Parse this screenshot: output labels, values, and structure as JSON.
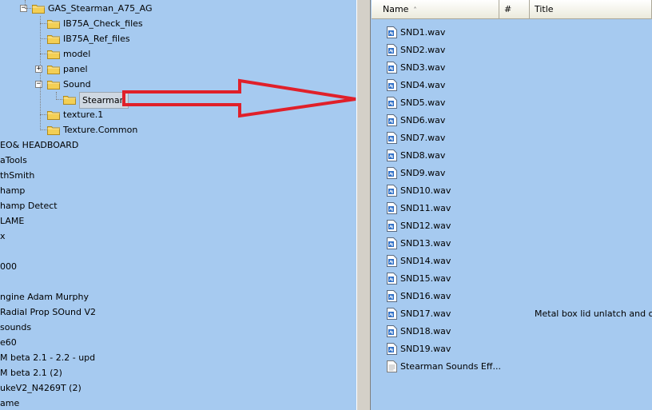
{
  "tree": {
    "items": [
      {
        "label": "GAS_Stearman_A75_AG",
        "type": "folder",
        "expander": "−"
      },
      {
        "label": "IB75A_Check_files",
        "type": "folder"
      },
      {
        "label": "IB75A_Ref_files",
        "type": "folder"
      },
      {
        "label": "model",
        "type": "folder"
      },
      {
        "label": "panel",
        "type": "folder",
        "expander": "+"
      },
      {
        "label": "Sound",
        "type": "folder",
        "expander": "−"
      },
      {
        "label": "Stearman",
        "type": "folder",
        "selected": true
      },
      {
        "label": "texture.1",
        "type": "folder"
      },
      {
        "label": "Texture.Common",
        "type": "folder"
      },
      {
        "label": "EO& HEADBOARD",
        "type": "text"
      },
      {
        "label": "aTools",
        "type": "text"
      },
      {
        "label": "thSmith",
        "type": "text"
      },
      {
        "label": "hamp",
        "type": "text"
      },
      {
        "label": "hamp Detect",
        "type": "text"
      },
      {
        "label": "LAME",
        "type": "text"
      },
      {
        "label": "x",
        "type": "text"
      },
      {
        "label": "",
        "type": "text"
      },
      {
        "label": "000",
        "type": "text"
      },
      {
        "label": "",
        "type": "text"
      },
      {
        "label": "ngine Adam Murphy",
        "type": "text"
      },
      {
        "label": "Radial Prop SOund V2",
        "type": "text"
      },
      {
        "label": "sounds",
        "type": "text"
      },
      {
        "label": "e60",
        "type": "text"
      },
      {
        "label": "M beta 2.1 - 2.2 - upd",
        "type": "text"
      },
      {
        "label": "M beta 2.1 (2)",
        "type": "text"
      },
      {
        "label": "ukeV2_N4269T (2)",
        "type": "text"
      },
      {
        "label": "ame",
        "type": "text"
      }
    ]
  },
  "list": {
    "columns": [
      {
        "label": "Name",
        "sort": "˄"
      },
      {
        "label": "#",
        "sort": ""
      },
      {
        "label": "Title",
        "sort": ""
      }
    ],
    "files": [
      {
        "name": "SND1.wav",
        "title": "",
        "icon": "wav-file-icon"
      },
      {
        "name": "SND2.wav",
        "title": "",
        "icon": "wav-file-icon"
      },
      {
        "name": "SND3.wav",
        "title": "",
        "icon": "wav-file-icon"
      },
      {
        "name": "SND4.wav",
        "title": "",
        "icon": "wav-file-icon"
      },
      {
        "name": "SND5.wav",
        "title": "",
        "icon": "wav-file-icon"
      },
      {
        "name": "SND6.wav",
        "title": "",
        "icon": "wav-file-icon"
      },
      {
        "name": "SND7.wav",
        "title": "",
        "icon": "wav-file-icon"
      },
      {
        "name": "SND8.wav",
        "title": "",
        "icon": "wav-file-icon"
      },
      {
        "name": "SND9.wav",
        "title": "",
        "icon": "wav-file-icon"
      },
      {
        "name": "SND10.wav",
        "title": "",
        "icon": "wav-file-icon"
      },
      {
        "name": "SND11.wav",
        "title": "",
        "icon": "wav-file-icon"
      },
      {
        "name": "SND12.wav",
        "title": "",
        "icon": "wav-file-icon"
      },
      {
        "name": "SND13.wav",
        "title": "",
        "icon": "wav-file-icon"
      },
      {
        "name": "SND14.wav",
        "title": "",
        "icon": "wav-file-icon"
      },
      {
        "name": "SND15.wav",
        "title": "",
        "icon": "wav-file-icon"
      },
      {
        "name": "SND16.wav",
        "title": "",
        "icon": "wav-file-icon"
      },
      {
        "name": "SND17.wav",
        "title": "Metal box lid unlatch and op...",
        "icon": "wav-file-icon"
      },
      {
        "name": "SND18.wav",
        "title": "",
        "icon": "wav-file-icon"
      },
      {
        "name": "SND19.wav",
        "title": "",
        "icon": "wav-file-icon"
      },
      {
        "name": "Stearman Sounds Eff...",
        "title": "",
        "icon": "text-file-icon"
      }
    ]
  },
  "colors": {
    "background": "#a6caf0",
    "arrow": "#e0202a",
    "folder": "#f3cf55"
  }
}
